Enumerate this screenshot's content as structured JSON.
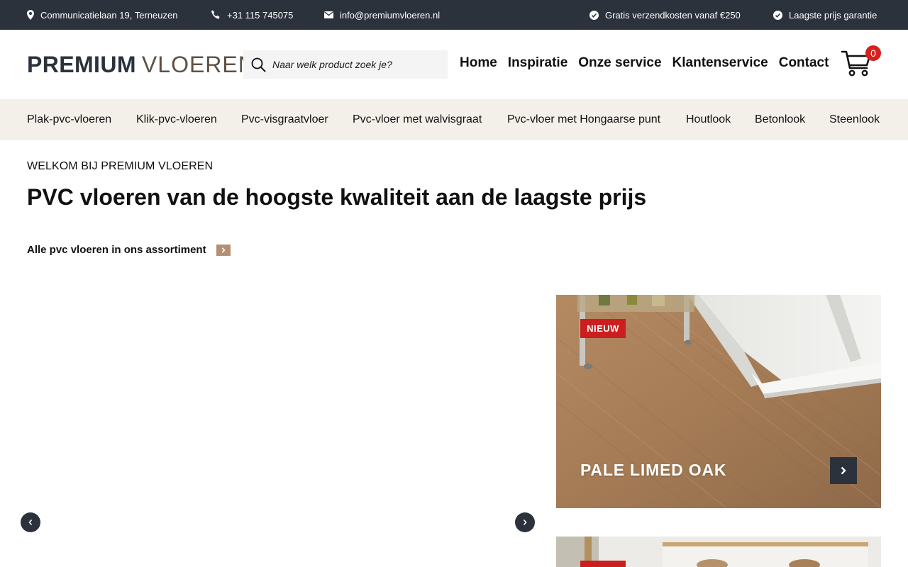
{
  "topbar": {
    "address": "Communicatielaan 19, Terneuzen",
    "phone": "+31 115 745075",
    "email": "info@premiumvloeren.nl",
    "usp1": "Gratis verzendkosten vanaf €250",
    "usp2": "Laagste prijs garantie"
  },
  "header": {
    "logo_bold": "PREMIUM",
    "logo_light": "VLOEREN",
    "search_placeholder": "Naar welk product zoek je?",
    "nav": [
      "Home",
      "Inspiratie",
      "Onze service",
      "Klantenservice",
      "Contact"
    ],
    "cart_count": "0"
  },
  "categories": [
    "Plak-pvc-vloeren",
    "Klik-pvc-vloeren",
    "Pvc-visgraatvloer",
    "Pvc-vloer met walvisgraat",
    "Pvc-vloer met Hongaarse punt",
    "Houtlook",
    "Betonlook",
    "Steenlook"
  ],
  "intro": {
    "welcome": "WELKOM BIJ PREMIUM VLOEREN",
    "headline": "PVC vloeren van de hoogste kwaliteit aan de laagste prijs",
    "assortment_link": "Alle pvc vloeren in ons assortiment"
  },
  "product_card": {
    "badge": "NIEUW",
    "title": "PALE LIMED OAK"
  },
  "colors": {
    "topbar_bg": "#2b323c",
    "catnav_bg": "#f3f0ea",
    "badge_red": "#cc1e1e",
    "cart_badge": "#d61f1f",
    "accent_tan": "#b39074"
  }
}
